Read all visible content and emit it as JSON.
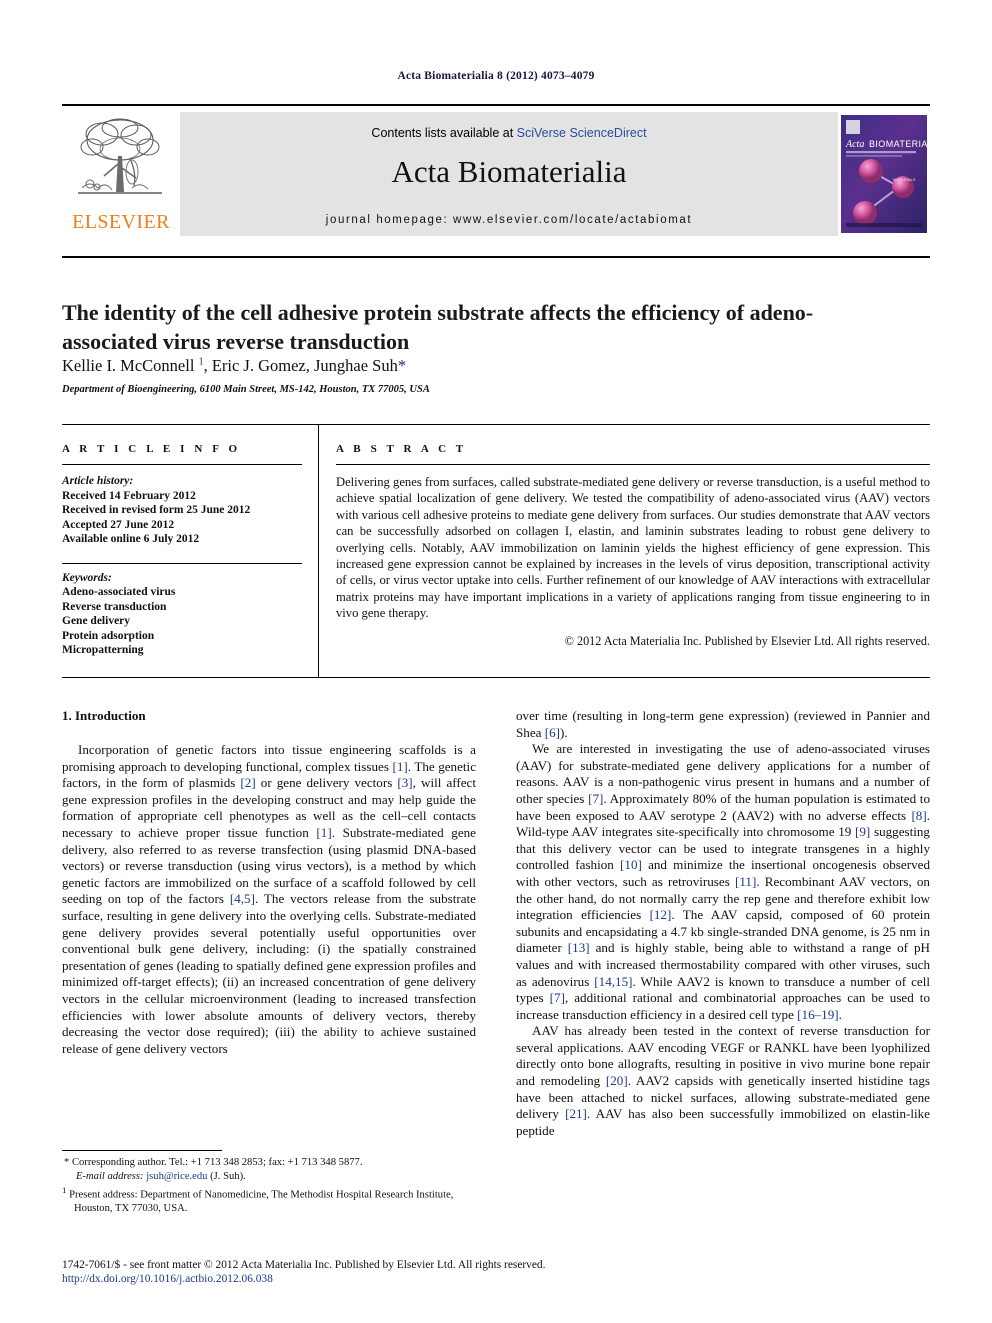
{
  "running_head": "Acta Biomaterialia 8 (2012) 4073–4079",
  "masthead": {
    "contents_prefix": "Contents lists available at ",
    "sciencedirect": "SciVerse ScienceDirect",
    "journal_title": "Acta Biomaterialia",
    "homepage_label": "journal homepage: www.elsevier.com/locate/actabiomat",
    "publisher_wordmark": "ELSEVIER",
    "cover_title_italic": "Acta",
    "cover_title_bold": "BIOMATERIALIA"
  },
  "article": {
    "title": "The identity of the cell adhesive protein substrate affects the efficiency of adeno-associated virus reverse transduction",
    "authors_html": "Kellie I. McConnell <sup>1</sup>, Eric J. Gomez, Junghae Suh<span class=\"star\">*</span>",
    "affiliation": "Department of Bioengineering, 6100 Main Street, MS-142, Houston, TX 77005, USA"
  },
  "article_info": {
    "heading": "A R T I C L E   I N F O",
    "history_label": "Article history:",
    "history": [
      "Received 14 February 2012",
      "Received in revised form 25 June 2012",
      "Accepted 27 June 2012",
      "Available online 6 July 2012"
    ],
    "keywords_label": "Keywords:",
    "keywords": [
      "Adeno-associated virus",
      "Reverse transduction",
      "Gene delivery",
      "Protein adsorption",
      "Micropatterning"
    ]
  },
  "abstract": {
    "heading": "A B S T R A C T",
    "text": "Delivering genes from surfaces, called substrate-mediated gene delivery or reverse transduction, is a useful method to achieve spatial localization of gene delivery. We tested the compatibility of adeno-associated virus (AAV) vectors with various cell adhesive proteins to mediate gene delivery from surfaces. Our studies demonstrate that AAV vectors can be successfully adsorbed on collagen I, elastin, and laminin substrates leading to robust gene delivery to overlying cells. Notably, AAV immobilization on laminin yields the highest efficiency of gene expression. This increased gene expression cannot be explained by increases in the levels of virus deposition, transcriptional activity of cells, or virus vector uptake into cells. Further refinement of our knowledge of AAV interactions with extracellular matrix proteins may have important implications in a variety of applications ranging from tissue engineering to in vivo gene therapy.",
    "copyright": "© 2012 Acta Materialia Inc. Published by Elsevier Ltd. All rights reserved."
  },
  "body": {
    "section_heading": "1. Introduction",
    "left_paragraphs": [
      "Incorporation of genetic factors into tissue engineering scaffolds is a promising approach to developing functional, complex tissues <span class=\"ref\">[1]</span>. The genetic factors, in the form of plasmids <span class=\"ref\">[2]</span> or gene delivery vectors <span class=\"ref\">[3]</span>, will affect gene expression profiles in the developing construct and may help guide the formation of appropriate cell phenotypes as well as the cell–cell contacts necessary to achieve proper tissue function <span class=\"ref\">[1]</span>. Substrate-mediated gene delivery, also referred to as reverse transfection (using plasmid DNA-based vectors) or reverse transduction (using virus vectors), is a method by which genetic factors are immobilized on the surface of a scaffold followed by cell seeding on top of the factors <span class=\"ref\">[4,5]</span>. The vectors release from the substrate surface, resulting in gene delivery into the overlying cells. Substrate-mediated gene delivery provides several potentially useful opportunities over conventional bulk gene delivery, including: (i) the spatially constrained presentation of genes (leading to spatially defined gene expression profiles and minimized off-target effects); (ii) an increased concentration of gene delivery vectors in the cellular microenvironment (leading to increased transfection efficiencies with lower absolute amounts of delivery vectors, thereby decreasing the vector dose required); (iii) the ability to achieve sustained release of gene delivery vectors"
    ],
    "right_paragraphs": [
      "over time (resulting in long-term gene expression) (reviewed in Pannier and Shea <span class=\"ref\">[6]</span>).",
      "We are interested in investigating the use of adeno-associated viruses (AAV) for substrate-mediated gene delivery applications for a number of reasons. AAV is a non-pathogenic virus present in humans and a number of other species <span class=\"ref\">[7]</span>. Approximately 80% of the human population is estimated to have been exposed to AAV serotype 2 (AAV2) with no adverse effects <span class=\"ref\">[8]</span>. Wild-type AAV integrates site-specifically into chromosome 19 <span class=\"ref\">[9]</span> suggesting that this delivery vector can be used to integrate transgenes in a highly controlled fashion <span class=\"ref\">[10]</span> and minimize the insertional oncogenesis observed with other vectors, such as retroviruses <span class=\"ref\">[11]</span>. Recombinant AAV vectors, on the other hand, do not normally carry the rep gene and therefore exhibit low integration efficiencies <span class=\"ref\">[12]</span>. The AAV capsid, composed of 60 protein subunits and encapsidating a 4.7 kb single-stranded DNA genome, is 25 nm in diameter <span class=\"ref\">[13]</span> and is highly stable, being able to withstand a range of pH values and with increased thermostability compared with other viruses, such as adenovirus <span class=\"ref\">[14,15]</span>. While AAV2 is known to transduce a number of cell types <span class=\"ref\">[7]</span>, additional rational and combinatorial approaches can be used to increase transduction efficiency in a desired cell type <span class=\"ref\">[16–19]</span>.",
      "AAV has already been tested in the context of reverse transduction for several applications. AAV encoding VEGF or RANKL have been lyophilized directly onto bone allografts, resulting in positive in vivo murine bone repair and remodeling <span class=\"ref\">[20]</span>. AAV2 capsids with genetically inserted histidine tags have been attached to nickel surfaces, allowing substrate-mediated gene delivery <span class=\"ref\">[21]</span>. AAV has also been successfully immobilized on elastin-like peptide"
    ]
  },
  "footnotes": {
    "corresponding": "* Corresponding author. Tel.: +1 713 348 2853; fax: +1 713 348 5877.",
    "email_label": "E-mail address:",
    "email": "jsuh@rice.edu",
    "email_suffix": "(J. Suh).",
    "present_address_marker": "1",
    "present_address": "Present address: Department of Nanomedicine, The Methodist Hospital Research Institute, Houston, TX 77030, USA."
  },
  "footer": {
    "issn_line": "1742-7061/$ - see front matter © 2012 Acta Materialia Inc. Published by Elsevier Ltd. All rights reserved.",
    "doi": "http://dx.doi.org/10.1016/j.actbio.2012.06.038"
  }
}
